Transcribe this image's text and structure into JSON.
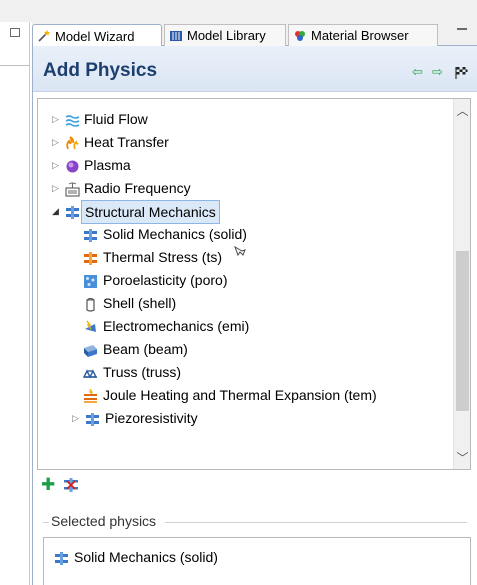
{
  "tabs": [
    {
      "label": "Model Wizard",
      "icon": "wand-icon",
      "active": true
    },
    {
      "label": "Model Library",
      "icon": "library-icon",
      "active": false
    },
    {
      "label": "Material Browser",
      "icon": "material-icon",
      "active": false
    }
  ],
  "header": {
    "title": "Add Physics"
  },
  "tree": {
    "items": [
      {
        "label": "Fluid Flow",
        "icon": "fluid-flow-icon"
      },
      {
        "label": "Heat Transfer",
        "icon": "heat-transfer-icon"
      },
      {
        "label": "Plasma",
        "icon": "plasma-icon"
      },
      {
        "label": "Radio Frequency",
        "icon": "radio-frequency-icon"
      },
      {
        "label": "Structural Mechanics",
        "icon": "structural-mechanics-icon"
      },
      {
        "label": "Solid Mechanics (solid)",
        "icon": "solid-mechanics-icon"
      },
      {
        "label": "Thermal Stress (ts)",
        "icon": "thermal-stress-icon"
      },
      {
        "label": "Poroelasticity (poro)",
        "icon": "poroelasticity-icon"
      },
      {
        "label": "Shell (shell)",
        "icon": "shell-icon"
      },
      {
        "label": "Electromechanics (emi)",
        "icon": "electromechanics-icon"
      },
      {
        "label": "Beam (beam)",
        "icon": "beam-icon"
      },
      {
        "label": "Truss (truss)",
        "icon": "truss-icon"
      },
      {
        "label": "Joule Heating and Thermal Expansion (tem)",
        "icon": "joule-heating-icon"
      },
      {
        "label": "Piezoresistivity",
        "icon": "piezoresistivity-icon"
      }
    ]
  },
  "selected_physics": {
    "section_label": "Selected physics",
    "items": [
      {
        "label": "Solid Mechanics (solid)",
        "icon": "solid-mechanics-icon"
      }
    ]
  },
  "colors": {
    "title": "#1d3f6e",
    "header_bg": "#dbe6f4",
    "selection_bg": "#dbe8f8",
    "add_green": "#1e9e4a"
  }
}
